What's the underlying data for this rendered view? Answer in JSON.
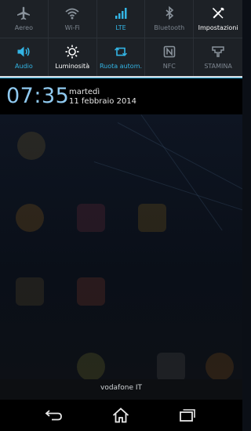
{
  "quick_settings": {
    "row1": [
      {
        "label": "Aereo",
        "icon": "airplane-icon",
        "state": "off"
      },
      {
        "label": "Wi-Fi",
        "icon": "wifi-icon",
        "state": "off"
      },
      {
        "label": "LTE",
        "icon": "signal-icon",
        "state": "on"
      },
      {
        "label": "Bluetooth",
        "icon": "bluetooth-icon",
        "state": "off"
      },
      {
        "label": "Impostazioni",
        "icon": "tools-icon",
        "state": "white"
      }
    ],
    "row2": [
      {
        "label": "Audio",
        "icon": "speaker-icon",
        "state": "on"
      },
      {
        "label": "Luminosità",
        "icon": "brightness-icon",
        "state": "white"
      },
      {
        "label": "Ruota autom.",
        "icon": "rotate-icon",
        "state": "on"
      },
      {
        "label": "NFC",
        "icon": "nfc-icon",
        "state": "off"
      },
      {
        "label": "STAMINA",
        "icon": "stamina-icon",
        "state": "off"
      }
    ]
  },
  "clock": {
    "time": "07:35",
    "day": "martedì",
    "date": "11 febbraio 2014"
  },
  "carrier": {
    "name": "vodafone IT"
  },
  "colors": {
    "accent": "#33b5e5",
    "inactive": "#7d8690",
    "panel": "#1d2126"
  }
}
